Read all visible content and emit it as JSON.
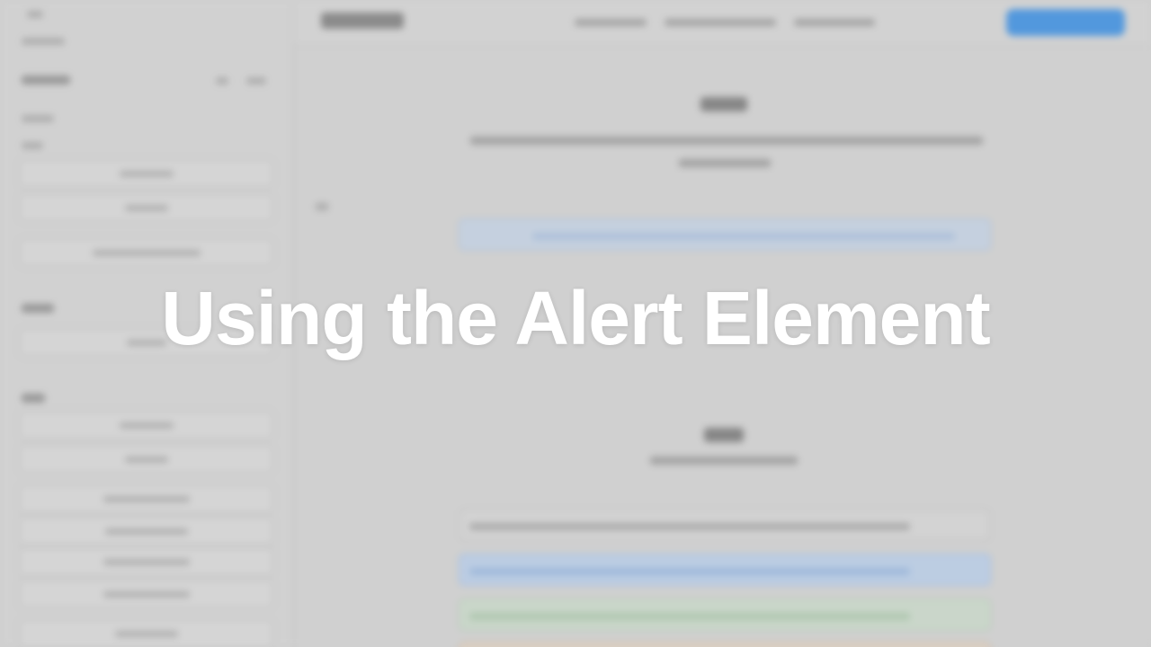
{
  "overlay": {
    "title": "Using the Alert Element"
  },
  "colors": {
    "accent": "#3d8fe0",
    "info_alert": "#c4d1e2",
    "primary_alert": "#b9cde6",
    "success_alert": "#c9d8c9",
    "warning_alert": "#dccfc1",
    "title_text": "#ffffff"
  },
  "icons": {
    "topbar_cta": "button-shape"
  }
}
